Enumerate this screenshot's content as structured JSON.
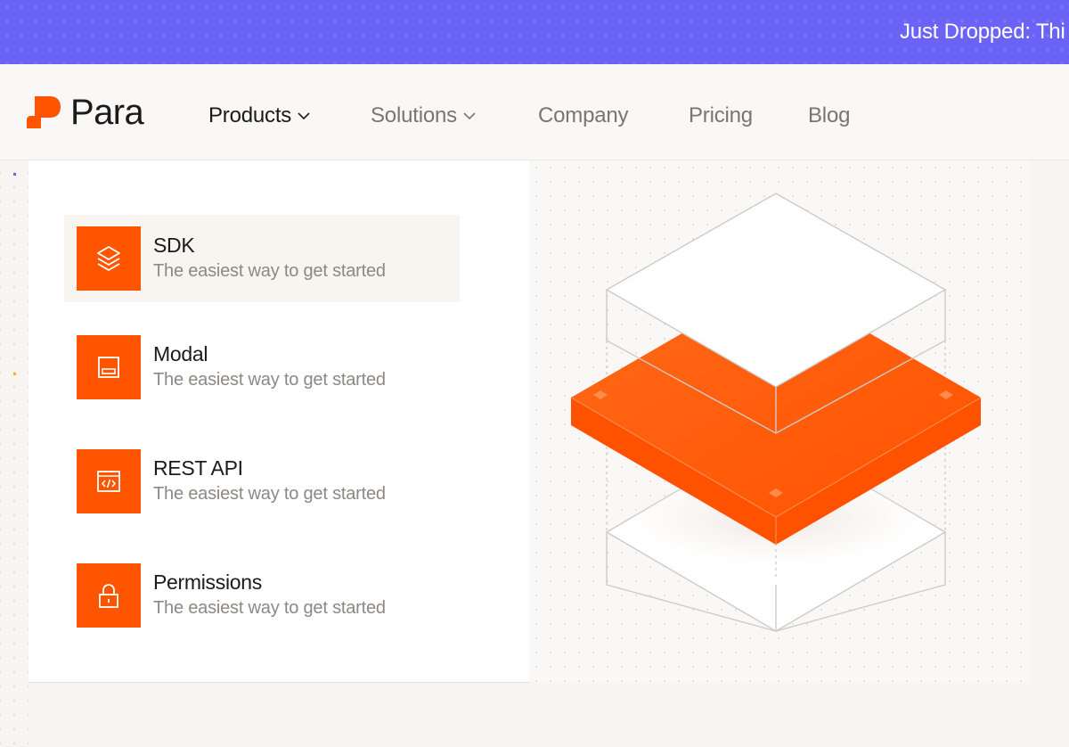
{
  "banner": {
    "text": "Just Dropped: Thi"
  },
  "brand": {
    "name": "Para",
    "color": "#ff5500"
  },
  "nav": [
    {
      "label": "Products",
      "dropdown": true,
      "active": true
    },
    {
      "label": "Solutions",
      "dropdown": true,
      "active": false
    },
    {
      "label": "Company",
      "dropdown": false,
      "active": false
    },
    {
      "label": "Pricing",
      "dropdown": false,
      "active": false
    },
    {
      "label": "Blog",
      "dropdown": false,
      "active": false
    }
  ],
  "menu": {
    "items": [
      {
        "title": "SDK",
        "description": "The easiest way to get started",
        "icon": "layers-icon",
        "highlighted": true
      },
      {
        "title": "Modal",
        "description": "The easiest way to get started",
        "icon": "modal-window-icon",
        "highlighted": false
      },
      {
        "title": "REST API",
        "description": "The easiest way to get started",
        "icon": "code-window-icon",
        "highlighted": false
      },
      {
        "title": "Permissions",
        "description": "The easiest way to get started",
        "icon": "lock-icon",
        "highlighted": false
      }
    ]
  },
  "colors": {
    "banner": "#6b63f5",
    "accent": "#ff5500",
    "text_primary": "#1b1b1b",
    "text_muted": "#8d8884"
  }
}
